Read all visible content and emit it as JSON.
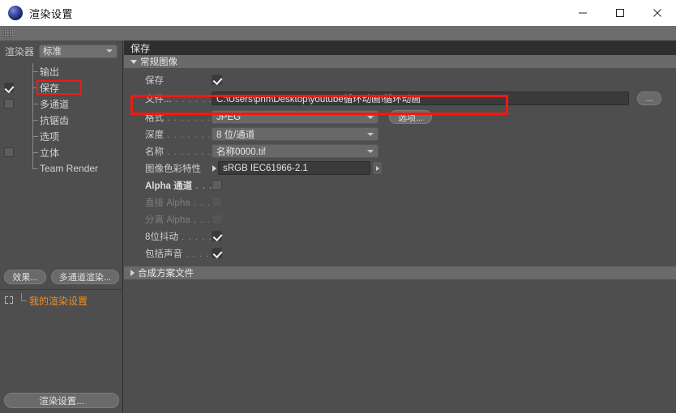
{
  "window": {
    "title": "渲染设置",
    "icon": "c4d-sphere-icon",
    "minimize_label": "minimize",
    "maximize_label": "maximize",
    "close_label": "close"
  },
  "sidebar": {
    "renderer_label": "渲染器",
    "renderer_value": "标准",
    "tree_items": [
      {
        "label": "输出",
        "checkbox": "none",
        "selected": false
      },
      {
        "label": "保存",
        "checkbox": "checked",
        "selected": true
      },
      {
        "label": "多通道",
        "checkbox": "unchecked",
        "selected": false
      },
      {
        "label": "抗锯齿",
        "checkbox": "none",
        "selected": false
      },
      {
        "label": "选项",
        "checkbox": "none",
        "selected": false
      },
      {
        "label": "立体",
        "checkbox": "unchecked",
        "selected": false
      },
      {
        "label": "Team Render",
        "checkbox": "none",
        "selected": false
      }
    ],
    "effects_button": "效果...",
    "multipass_button": "多通道渲染...",
    "preset_item": "我的渲染设置",
    "bottom_button": "渲染设置..."
  },
  "main": {
    "panel_title": "保存",
    "section_regular": "常规图像",
    "section_compositing": "合成方案文件",
    "rows": {
      "save_label": "保存",
      "save_checked": true,
      "file_label": "文件...",
      "file_value": "C:\\Users\\phh\\Desktop\\youtube循环动画\\循环动画",
      "browse_button": "...",
      "format_label": "格式",
      "format_value": "JPEG",
      "options_button": "选项...",
      "depth_label": "深度",
      "depth_value": "8 位/通道",
      "name_label": "名称",
      "name_value": "名称0000.tif",
      "colorprofile_label": "图像色彩特性",
      "colorprofile_value": "sRGB IEC61966-2.1",
      "alpha_label": "Alpha 通道",
      "alpha_checked": false,
      "straight_alpha_label": "直接 Alpha",
      "straight_alpha_checked": false,
      "separate_alpha_label": "分离 Alpha",
      "separate_alpha_checked": false,
      "dither_label": "8位抖动",
      "dither_checked": true,
      "sound_label": "包括声音",
      "sound_checked": true
    }
  },
  "colors": {
    "highlight": "#f01a12",
    "accent_text": "#ef8e27",
    "panel_bg": "#4e4e4e",
    "section_bar": "#6a6a6a"
  }
}
